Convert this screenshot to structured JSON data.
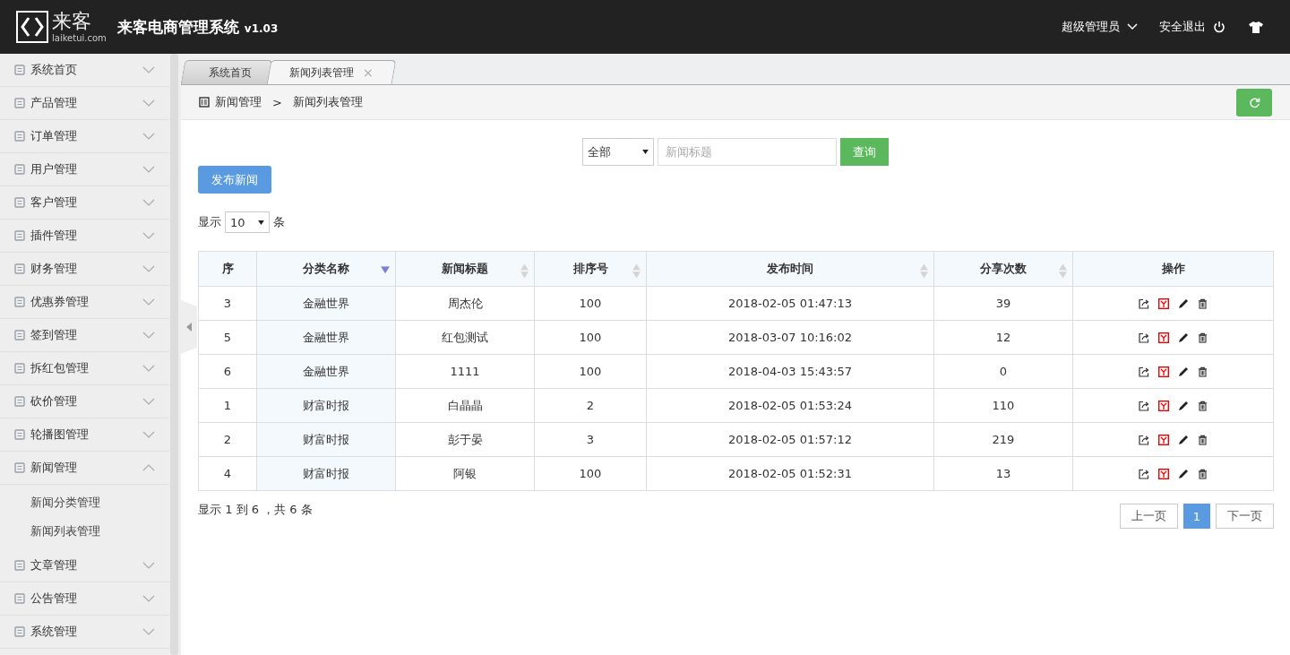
{
  "header": {
    "logo_text": "来客",
    "logo_domain": "laiketui.com",
    "title": "来客电商管理系统",
    "version": "v1.03",
    "user": "超级管理员",
    "logout": "安全退出"
  },
  "sidebar": {
    "items": [
      {
        "label": "系统首页",
        "expanded": false
      },
      {
        "label": "产品管理",
        "expanded": false
      },
      {
        "label": "订单管理",
        "expanded": false
      },
      {
        "label": "用户管理",
        "expanded": false
      },
      {
        "label": "客户管理",
        "expanded": false
      },
      {
        "label": "插件管理",
        "expanded": false
      },
      {
        "label": "财务管理",
        "expanded": false
      },
      {
        "label": "优惠券管理",
        "expanded": false
      },
      {
        "label": "签到管理",
        "expanded": false
      },
      {
        "label": "拆红包管理",
        "expanded": false
      },
      {
        "label": "砍价管理",
        "expanded": false
      },
      {
        "label": "轮播图管理",
        "expanded": false
      },
      {
        "label": "新闻管理",
        "expanded": true,
        "children": [
          {
            "label": "新闻分类管理"
          },
          {
            "label": "新闻列表管理"
          }
        ]
      },
      {
        "label": "文章管理",
        "expanded": false
      },
      {
        "label": "公告管理",
        "expanded": false
      },
      {
        "label": "系统管理",
        "expanded": false
      }
    ]
  },
  "tabs": [
    {
      "label": "系统首页",
      "selected": false
    },
    {
      "label": "新闻列表管理",
      "selected": true,
      "close": "×"
    }
  ],
  "breadcrumb": {
    "items": [
      "新闻管理",
      "新闻列表管理"
    ],
    "separator": ">"
  },
  "filter": {
    "category": "全部",
    "placeholder": "新闻标题",
    "button": "查询"
  },
  "publish_button": "发布新闻",
  "page_length": {
    "prefix": "显示",
    "value": "10",
    "suffix": "条"
  },
  "table": {
    "columns": [
      {
        "label": "序",
        "sortable": false
      },
      {
        "label": "分类名称",
        "sortable": true,
        "sorted": true
      },
      {
        "label": "新闻标题",
        "sortable": true,
        "sorted": false
      },
      {
        "label": "排序号",
        "sortable": true,
        "sorted": false
      },
      {
        "label": "发布时间",
        "sortable": true,
        "sorted": false
      },
      {
        "label": "分享次数",
        "sortable": true,
        "sorted": false
      },
      {
        "label": "操作",
        "sortable": false
      }
    ],
    "rows": [
      [
        "3",
        "金融世界",
        "周杰伦",
        "100",
        "2018-02-05 01:47:13",
        "39"
      ],
      [
        "5",
        "金融世界",
        "红包测试",
        "100",
        "2018-03-07 10:16:02",
        "12"
      ],
      [
        "6",
        "金融世界",
        "1111",
        "100",
        "2018-04-03 15:43:57",
        "0"
      ],
      [
        "1",
        "财富时报",
        "白晶晶",
        "2",
        "2018-02-05 01:53:24",
        "110"
      ],
      [
        "2",
        "财富时报",
        "彭于晏",
        "3",
        "2018-02-05 01:57:12",
        "219"
      ],
      [
        "4",
        "财富时报",
        "阿银",
        "100",
        "2018-02-05 01:52:31",
        "13"
      ]
    ]
  },
  "summary": "显示 1 到 6 ，共 6 条",
  "pagination": {
    "prev": "上一页",
    "pages": [
      {
        "label": "1",
        "selected": true
      }
    ],
    "next": "下一页"
  }
}
